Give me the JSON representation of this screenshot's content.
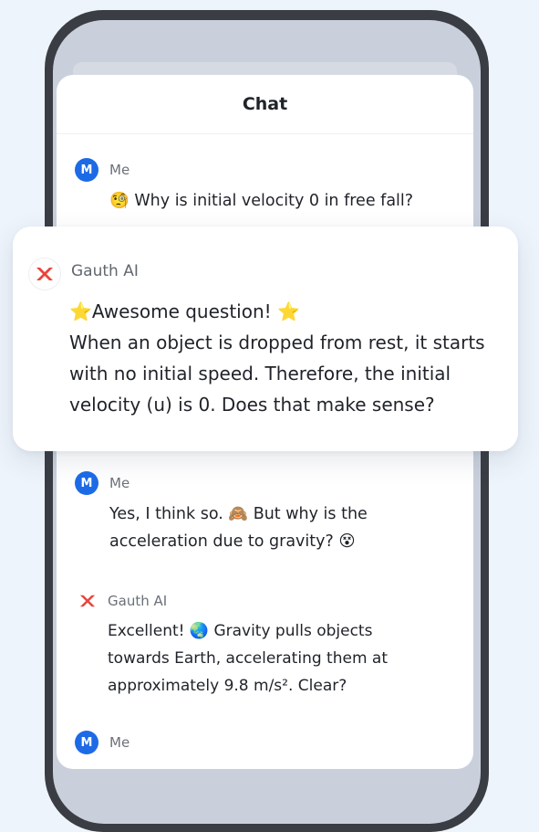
{
  "chat": {
    "title": "Chat"
  },
  "messages": [
    {
      "sender": "Me",
      "avatar": "M",
      "emoji": "🧐",
      "text": "Why is initial velocity 0 in free fall?"
    },
    {
      "sender": "Gauth AI",
      "lines": [
        "⭐Awesome question! ⭐",
        "When an object is dropped from rest, it starts",
        "with no initial speed. Therefore, the initial",
        "velocity (u) is 0. Does that make sense?"
      ]
    },
    {
      "sender": "Me",
      "avatar": "M",
      "lines": [
        "Yes, I think so. 🙈 But why is the",
        "acceleration due to gravity? 😵"
      ]
    },
    {
      "sender": "Gauth AI",
      "lines": [
        "Excellent! 🌏 Gravity pulls objects",
        "towards Earth, accelerating them at",
        "approximately 9.8 m/s². Clear?"
      ]
    },
    {
      "sender": "Me",
      "avatar": "M"
    }
  ],
  "colors": {
    "accent": "#1d6ae6",
    "logo": "#e8453c",
    "background": "#eef4fb"
  }
}
